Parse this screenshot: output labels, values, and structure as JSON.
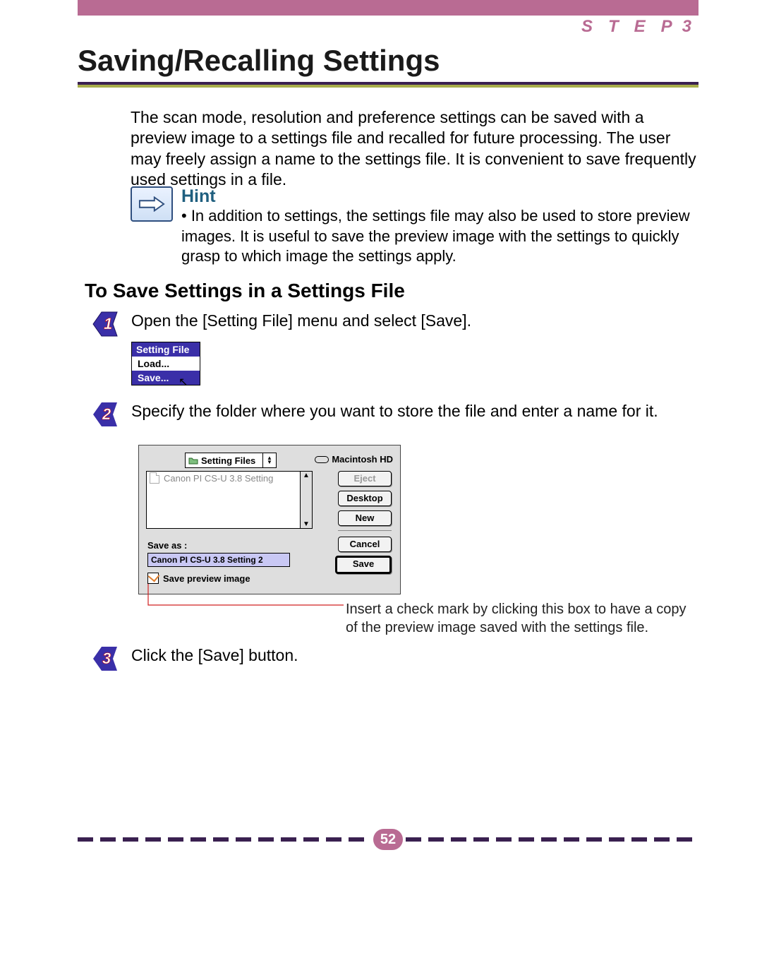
{
  "header": {
    "step_word": "STEP",
    "step_number": "3"
  },
  "title": "Saving/Recalling Settings",
  "intro": "The scan mode, resolution and preference settings can be saved with a preview image to a settings file and recalled for future processing. The user may freely assign a name to the settings file. It is convenient to save frequently used settings in a file.",
  "hint": {
    "title": "Hint",
    "text": "• In addition to settings, the settings file may also be used to store preview images. It is useful to save the preview image with the settings to quickly grasp to which image the settings apply."
  },
  "subheading": "To Save Settings in a Settings File",
  "steps": {
    "s1": "Open the [Setting File] menu and select [Save].",
    "s2": "Specify the folder where you want to store the file and enter a name for it.",
    "s3": "Click the [Save] button."
  },
  "menu": {
    "title": "Setting File",
    "item_load": "Load...",
    "item_save": "Save..."
  },
  "dialog": {
    "folder_dropdown": "Setting Files",
    "drive": "Macintosh HD",
    "file_row": "Canon PI CS-U 3.8 Setting",
    "btn_eject": "Eject",
    "btn_desktop": "Desktop",
    "btn_new": "New",
    "btn_cancel": "Cancel",
    "btn_save": "Save",
    "save_as_label": "Save as :",
    "save_as_value": "Canon PI CS-U 3.8 Setting 2",
    "checkbox_label": "Save preview image"
  },
  "callout": "Insert a check mark by clicking this box to have a copy of the preview image saved with the settings file.",
  "page_number": "52"
}
